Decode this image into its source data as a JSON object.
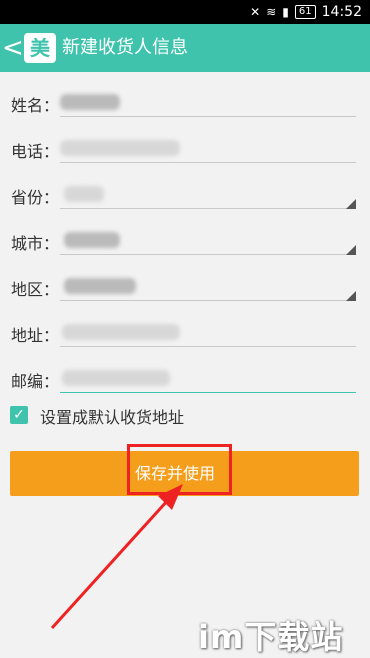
{
  "status": {
    "battery": "61",
    "time": "14:52"
  },
  "header": {
    "back_glyph": "<",
    "logo_text": "美",
    "title": "新建收货人信息"
  },
  "form": {
    "fields": [
      {
        "label": "姓名："
      },
      {
        "label": "电话："
      },
      {
        "label": "省份："
      },
      {
        "label": "城市："
      },
      {
        "label": "地区："
      },
      {
        "label": "地址："
      },
      {
        "label": "邮编："
      }
    ],
    "default_checkbox_label": "设置成默认收货地址"
  },
  "actions": {
    "save_label": "保存并使用"
  },
  "watermark": "im下载站",
  "colors": {
    "theme": "#3fc3ac",
    "button": "#f59e1b",
    "highlight": "#e22222"
  },
  "icons": [
    "back-arrow-icon",
    "meituan-logo-icon",
    "wifi-icon",
    "signal-icon",
    "battery-icon",
    "dropdown-corner-icon",
    "checkmark-icon"
  ]
}
